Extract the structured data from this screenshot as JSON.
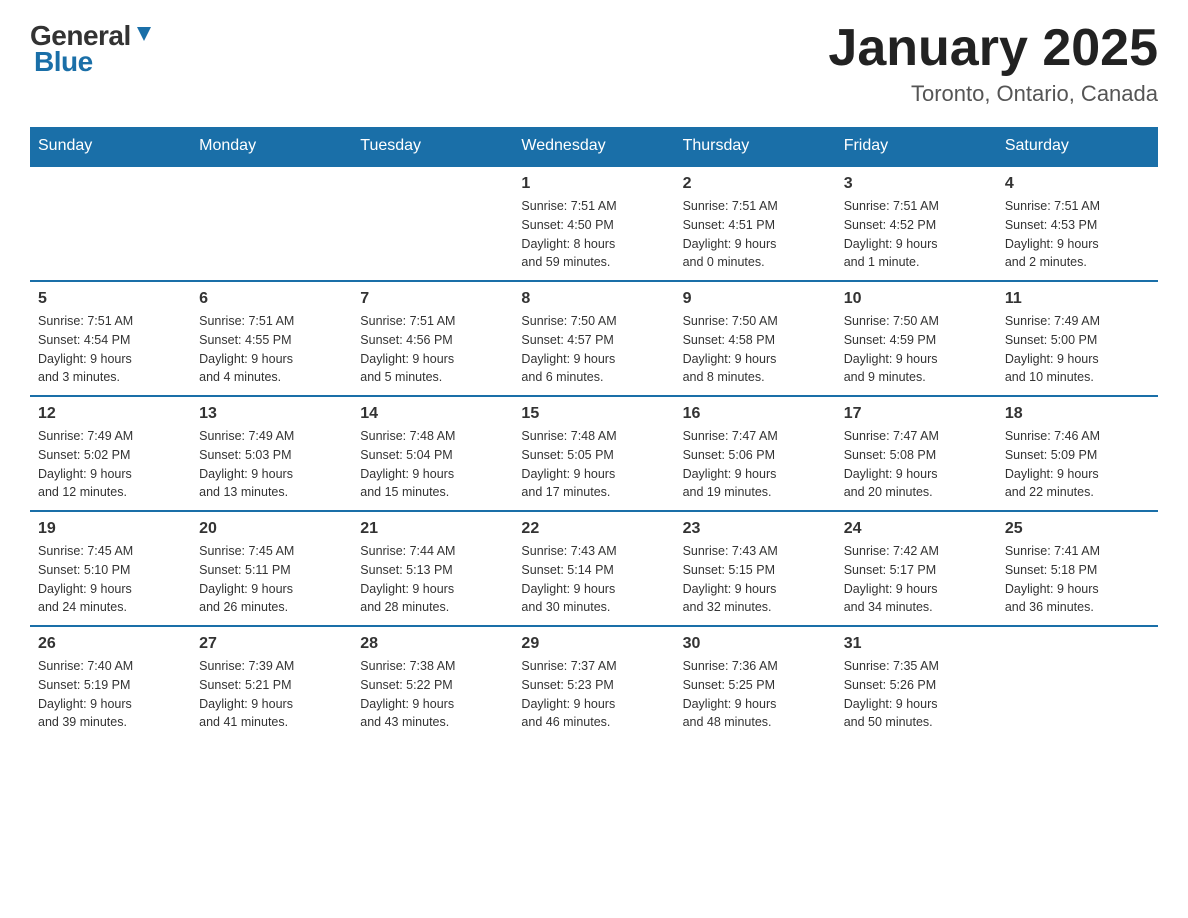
{
  "logo": {
    "general": "General",
    "blue": "Blue"
  },
  "title": "January 2025",
  "location": "Toronto, Ontario, Canada",
  "weekdays": [
    "Sunday",
    "Monday",
    "Tuesday",
    "Wednesday",
    "Thursday",
    "Friday",
    "Saturday"
  ],
  "weeks": [
    [
      {
        "day": "",
        "info": ""
      },
      {
        "day": "",
        "info": ""
      },
      {
        "day": "",
        "info": ""
      },
      {
        "day": "1",
        "info": "Sunrise: 7:51 AM\nSunset: 4:50 PM\nDaylight: 8 hours\nand 59 minutes."
      },
      {
        "day": "2",
        "info": "Sunrise: 7:51 AM\nSunset: 4:51 PM\nDaylight: 9 hours\nand 0 minutes."
      },
      {
        "day": "3",
        "info": "Sunrise: 7:51 AM\nSunset: 4:52 PM\nDaylight: 9 hours\nand 1 minute."
      },
      {
        "day": "4",
        "info": "Sunrise: 7:51 AM\nSunset: 4:53 PM\nDaylight: 9 hours\nand 2 minutes."
      }
    ],
    [
      {
        "day": "5",
        "info": "Sunrise: 7:51 AM\nSunset: 4:54 PM\nDaylight: 9 hours\nand 3 minutes."
      },
      {
        "day": "6",
        "info": "Sunrise: 7:51 AM\nSunset: 4:55 PM\nDaylight: 9 hours\nand 4 minutes."
      },
      {
        "day": "7",
        "info": "Sunrise: 7:51 AM\nSunset: 4:56 PM\nDaylight: 9 hours\nand 5 minutes."
      },
      {
        "day": "8",
        "info": "Sunrise: 7:50 AM\nSunset: 4:57 PM\nDaylight: 9 hours\nand 6 minutes."
      },
      {
        "day": "9",
        "info": "Sunrise: 7:50 AM\nSunset: 4:58 PM\nDaylight: 9 hours\nand 8 minutes."
      },
      {
        "day": "10",
        "info": "Sunrise: 7:50 AM\nSunset: 4:59 PM\nDaylight: 9 hours\nand 9 minutes."
      },
      {
        "day": "11",
        "info": "Sunrise: 7:49 AM\nSunset: 5:00 PM\nDaylight: 9 hours\nand 10 minutes."
      }
    ],
    [
      {
        "day": "12",
        "info": "Sunrise: 7:49 AM\nSunset: 5:02 PM\nDaylight: 9 hours\nand 12 minutes."
      },
      {
        "day": "13",
        "info": "Sunrise: 7:49 AM\nSunset: 5:03 PM\nDaylight: 9 hours\nand 13 minutes."
      },
      {
        "day": "14",
        "info": "Sunrise: 7:48 AM\nSunset: 5:04 PM\nDaylight: 9 hours\nand 15 minutes."
      },
      {
        "day": "15",
        "info": "Sunrise: 7:48 AM\nSunset: 5:05 PM\nDaylight: 9 hours\nand 17 minutes."
      },
      {
        "day": "16",
        "info": "Sunrise: 7:47 AM\nSunset: 5:06 PM\nDaylight: 9 hours\nand 19 minutes."
      },
      {
        "day": "17",
        "info": "Sunrise: 7:47 AM\nSunset: 5:08 PM\nDaylight: 9 hours\nand 20 minutes."
      },
      {
        "day": "18",
        "info": "Sunrise: 7:46 AM\nSunset: 5:09 PM\nDaylight: 9 hours\nand 22 minutes."
      }
    ],
    [
      {
        "day": "19",
        "info": "Sunrise: 7:45 AM\nSunset: 5:10 PM\nDaylight: 9 hours\nand 24 minutes."
      },
      {
        "day": "20",
        "info": "Sunrise: 7:45 AM\nSunset: 5:11 PM\nDaylight: 9 hours\nand 26 minutes."
      },
      {
        "day": "21",
        "info": "Sunrise: 7:44 AM\nSunset: 5:13 PM\nDaylight: 9 hours\nand 28 minutes."
      },
      {
        "day": "22",
        "info": "Sunrise: 7:43 AM\nSunset: 5:14 PM\nDaylight: 9 hours\nand 30 minutes."
      },
      {
        "day": "23",
        "info": "Sunrise: 7:43 AM\nSunset: 5:15 PM\nDaylight: 9 hours\nand 32 minutes."
      },
      {
        "day": "24",
        "info": "Sunrise: 7:42 AM\nSunset: 5:17 PM\nDaylight: 9 hours\nand 34 minutes."
      },
      {
        "day": "25",
        "info": "Sunrise: 7:41 AM\nSunset: 5:18 PM\nDaylight: 9 hours\nand 36 minutes."
      }
    ],
    [
      {
        "day": "26",
        "info": "Sunrise: 7:40 AM\nSunset: 5:19 PM\nDaylight: 9 hours\nand 39 minutes."
      },
      {
        "day": "27",
        "info": "Sunrise: 7:39 AM\nSunset: 5:21 PM\nDaylight: 9 hours\nand 41 minutes."
      },
      {
        "day": "28",
        "info": "Sunrise: 7:38 AM\nSunset: 5:22 PM\nDaylight: 9 hours\nand 43 minutes."
      },
      {
        "day": "29",
        "info": "Sunrise: 7:37 AM\nSunset: 5:23 PM\nDaylight: 9 hours\nand 46 minutes."
      },
      {
        "day": "30",
        "info": "Sunrise: 7:36 AM\nSunset: 5:25 PM\nDaylight: 9 hours\nand 48 minutes."
      },
      {
        "day": "31",
        "info": "Sunrise: 7:35 AM\nSunset: 5:26 PM\nDaylight: 9 hours\nand 50 minutes."
      },
      {
        "day": "",
        "info": ""
      }
    ]
  ]
}
